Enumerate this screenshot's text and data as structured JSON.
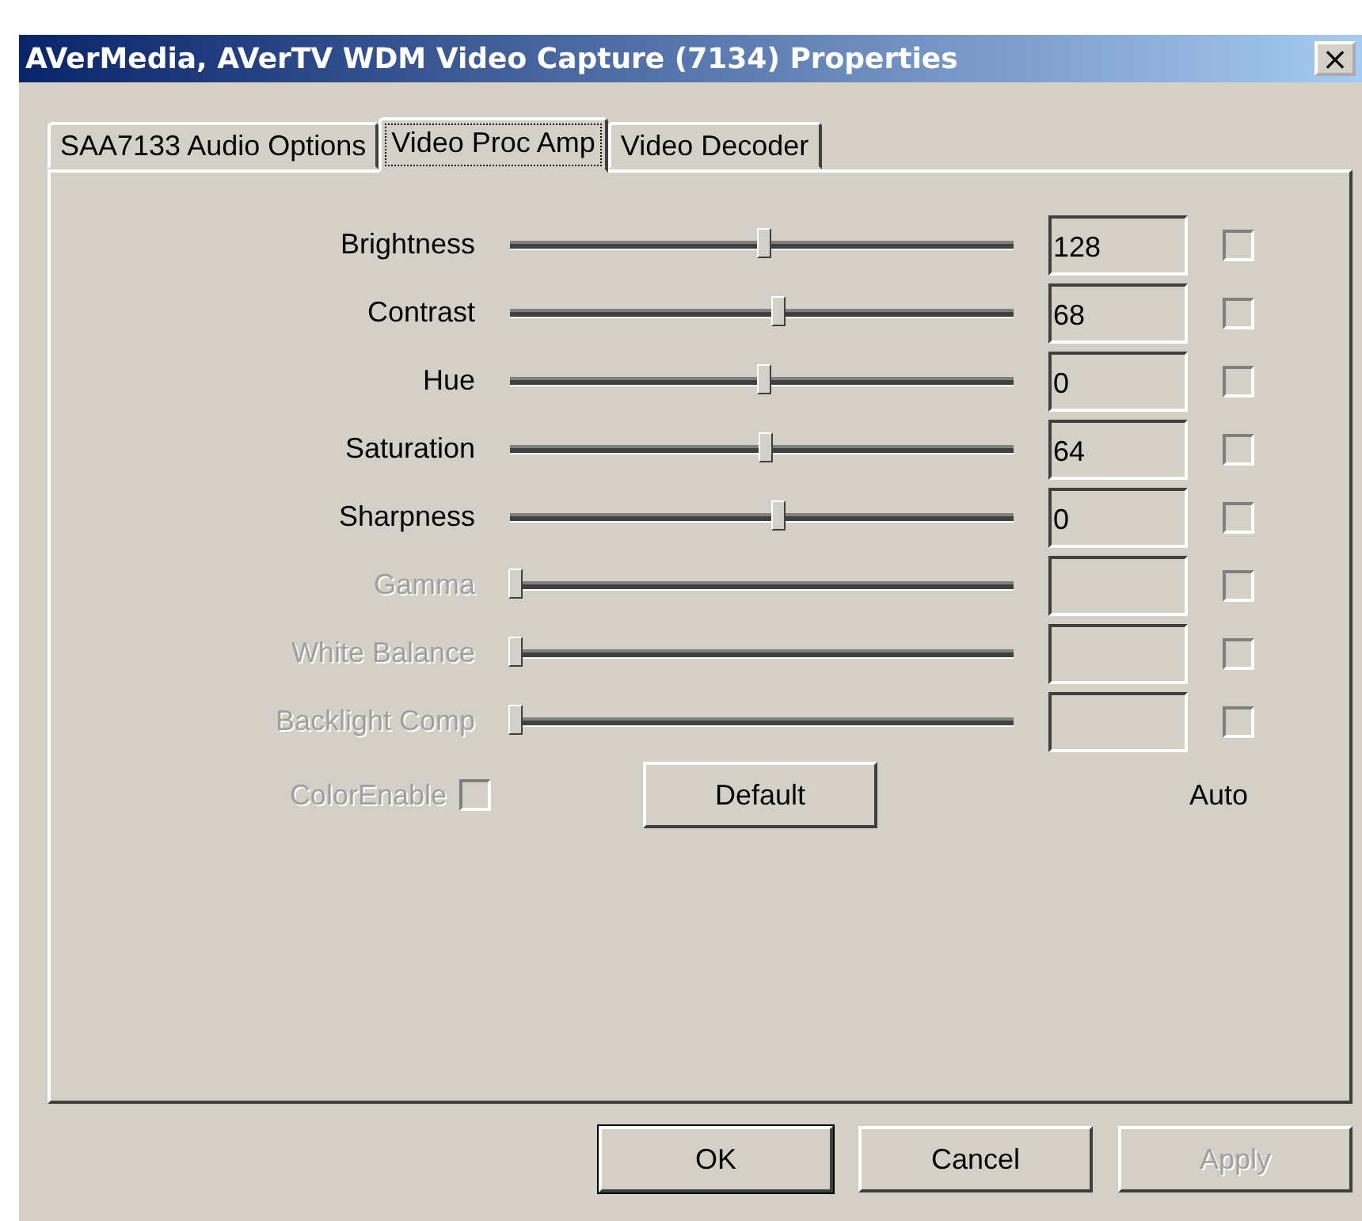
{
  "window": {
    "title": "AVerMedia, AVerTV WDM Video Capture (7134) Properties",
    "close": "×"
  },
  "tabs": [
    {
      "label": "SAA7133 Audio Options",
      "selected": false
    },
    {
      "label": "Video Proc Amp",
      "selected": true
    },
    {
      "label": "Video Decoder",
      "selected": false
    }
  ],
  "controls": [
    {
      "label": "Brightness",
      "level": 0.505,
      "value": "128",
      "auto": false,
      "disabled": false
    },
    {
      "label": "Contrast",
      "level": 0.535,
      "value": "68",
      "auto": false,
      "disabled": false
    },
    {
      "label": "Hue",
      "level": 0.505,
      "value": "0",
      "auto": false,
      "disabled": false
    },
    {
      "label": "Saturation",
      "level": 0.51,
      "value": "64",
      "auto": false,
      "disabled": false
    },
    {
      "label": "Sharpness",
      "level": 0.535,
      "value": "0",
      "auto": false,
      "disabled": false
    },
    {
      "label": "Gamma",
      "level": 0,
      "auto": false,
      "disabled": true
    },
    {
      "label": "White Balance",
      "level": 0,
      "auto": false,
      "disabled": true
    },
    {
      "label": "Backlight Comp",
      "level": 0,
      "auto": false,
      "disabled": true
    }
  ],
  "color_enable": {
    "label": "ColorEnable",
    "checked": false,
    "disabled": true
  },
  "default_button": "Default",
  "auto_label": "Auto",
  "buttons": [
    {
      "label": "OK",
      "default": true,
      "disabled": false
    },
    {
      "label": "Cancel",
      "default": false,
      "disabled": false
    },
    {
      "label": "Apply",
      "default": false,
      "disabled": true
    }
  ]
}
